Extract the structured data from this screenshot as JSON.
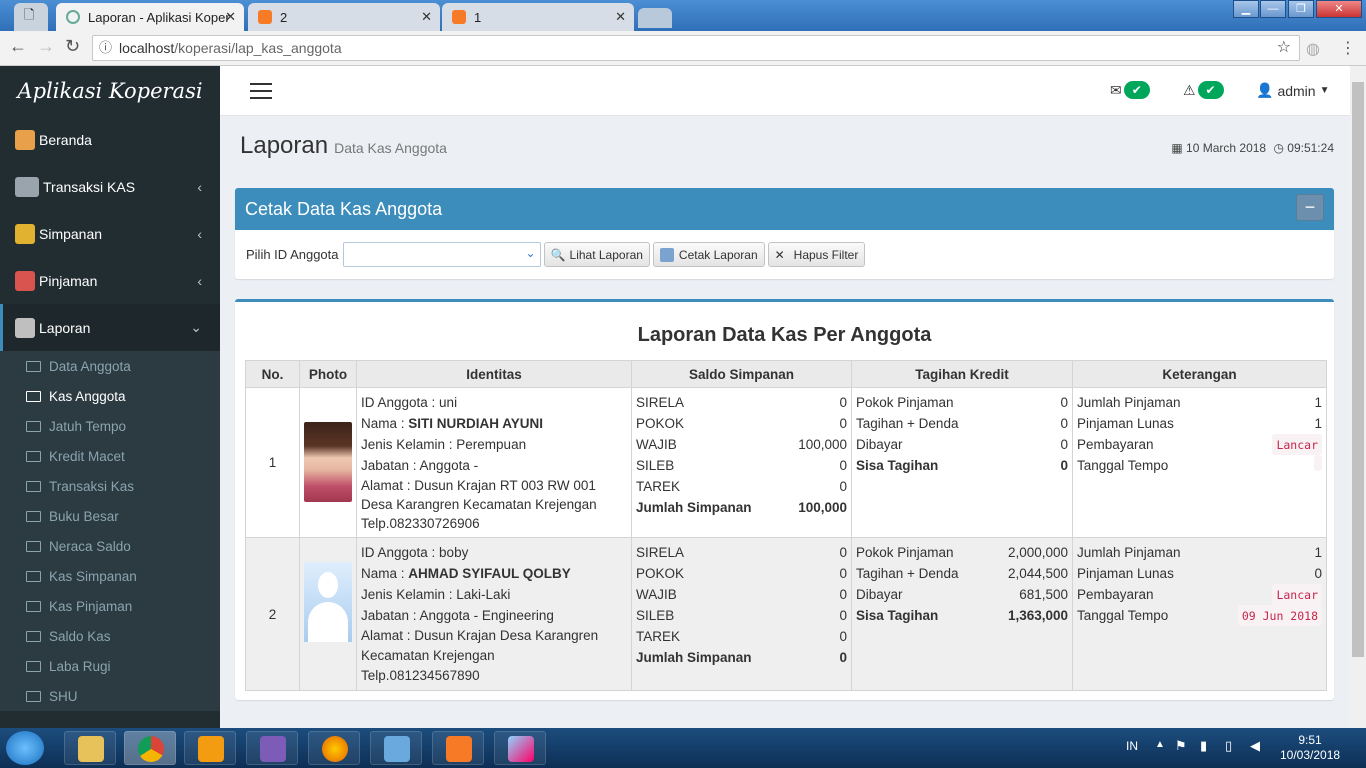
{
  "browser": {
    "tabs": [
      {
        "title": "Laporan - Aplikasi Koper",
        "active": true
      },
      {
        "title": "2",
        "active": false
      },
      {
        "title": "1",
        "active": false
      }
    ],
    "url_host": "localhost",
    "url_path": "/koperasi/lap_kas_anggota"
  },
  "sidebar": {
    "app_title": "Aplikasi Koperasi",
    "menu": [
      {
        "label": "Beranda",
        "icon": "home-icon",
        "color": "#e8a04a"
      },
      {
        "label": "Transaksi KAS",
        "icon": "cash-register-icon",
        "color": "#9aa4ad"
      },
      {
        "label": "Simpanan",
        "icon": "money-bag-icon",
        "color": "#e0b22f"
      },
      {
        "label": "Pinjaman",
        "icon": "people-icon",
        "color": "#d9534f"
      },
      {
        "label": "Laporan",
        "icon": "report-icon",
        "color": "#bfbfbf"
      }
    ],
    "submenu": [
      "Data Anggota",
      "Kas Anggota",
      "Jatuh Tempo",
      "Kredit Macet",
      "Transaksi Kas",
      "Buku Besar",
      "Neraca Saldo",
      "Kas Simpanan",
      "Kas Pinjaman",
      "Saldo Kas",
      "Laba Rugi",
      "SHU"
    ],
    "submenu_active": "Kas Anggota"
  },
  "header": {
    "user": "admin"
  },
  "page": {
    "title": "Laporan",
    "subtitle": "Data Kas Anggota",
    "date": "10 March 2018",
    "time": "09:51:24"
  },
  "filter_box": {
    "title": "Cetak Data Kas Anggota",
    "label": "Pilih ID Anggota",
    "select_value": "",
    "btn_view": "Lihat Laporan",
    "btn_print": "Cetak Laporan",
    "btn_clear": "Hapus Filter"
  },
  "report": {
    "title": "Laporan Data Kas Per Anggota",
    "columns": [
      "No.",
      "Photo",
      "Identitas",
      "Saldo Simpanan",
      "Tagihan Kredit",
      "Keterangan"
    ],
    "rows": [
      {
        "no": "1",
        "identitas": [
          "ID Anggota : uni",
          "Nama : ",
          "SITI NURDIAH AYUNI",
          "Jenis Kelamin : Perempuan",
          "Jabatan : Anggota -",
          "Alamat : Dusun Krajan RT 003 RW 001 Desa Karangren Kecamatan Krejengan Telp.082330726906"
        ],
        "simpanan": [
          [
            "SIRELA",
            "0"
          ],
          [
            "POKOK",
            "0"
          ],
          [
            "WAJIB",
            "100,000"
          ],
          [
            "SILEB",
            "0"
          ],
          [
            "TAREK",
            "0"
          ]
        ],
        "jumlah_label": "Jumlah Simpanan",
        "jumlah": "100,000",
        "kredit": [
          [
            "Pokok Pinjaman",
            "0"
          ],
          [
            "Tagihan + Denda",
            "0"
          ],
          [
            "Dibayar",
            "0"
          ]
        ],
        "sisa_label": "Sisa Tagihan",
        "sisa": "0",
        "ket": [
          [
            "Jumlah Pinjaman",
            "1"
          ],
          [
            "Pinjaman Lunas",
            "1"
          ],
          [
            "Pembayaran",
            "Lancar"
          ],
          [
            "Tanggal Tempo",
            ""
          ]
        ]
      },
      {
        "no": "2",
        "identitas": [
          "ID Anggota : boby",
          "Nama : ",
          "AHMAD SYIFAUL QOLBY",
          "Jenis Kelamin : Laki-Laki",
          "Jabatan : Anggota - Engineering",
          "Alamat : Dusun Krajan Desa Karangren Kecamatan Krejengan Telp.081234567890"
        ],
        "simpanan": [
          [
            "SIRELA",
            "0"
          ],
          [
            "POKOK",
            "0"
          ],
          [
            "WAJIB",
            "0"
          ],
          [
            "SILEB",
            "0"
          ],
          [
            "TAREK",
            "0"
          ]
        ],
        "jumlah_label": "Jumlah Simpanan",
        "jumlah": "0",
        "kredit": [
          [
            "Pokok Pinjaman",
            "2,000,000"
          ],
          [
            "Tagihan + Denda",
            "2,044,500"
          ],
          [
            "Dibayar",
            "681,500"
          ]
        ],
        "sisa_label": "Sisa Tagihan",
        "sisa": "1,363,000",
        "ket": [
          [
            "Jumlah Pinjaman",
            "1"
          ],
          [
            "Pinjaman Lunas",
            "0"
          ],
          [
            "Pembayaran",
            "Lancar"
          ],
          [
            "Tanggal Tempo",
            "09 Jun 2018"
          ]
        ]
      }
    ]
  },
  "taskbar": {
    "lang": "IN",
    "time": "9:51",
    "date": "10/03/2018"
  }
}
